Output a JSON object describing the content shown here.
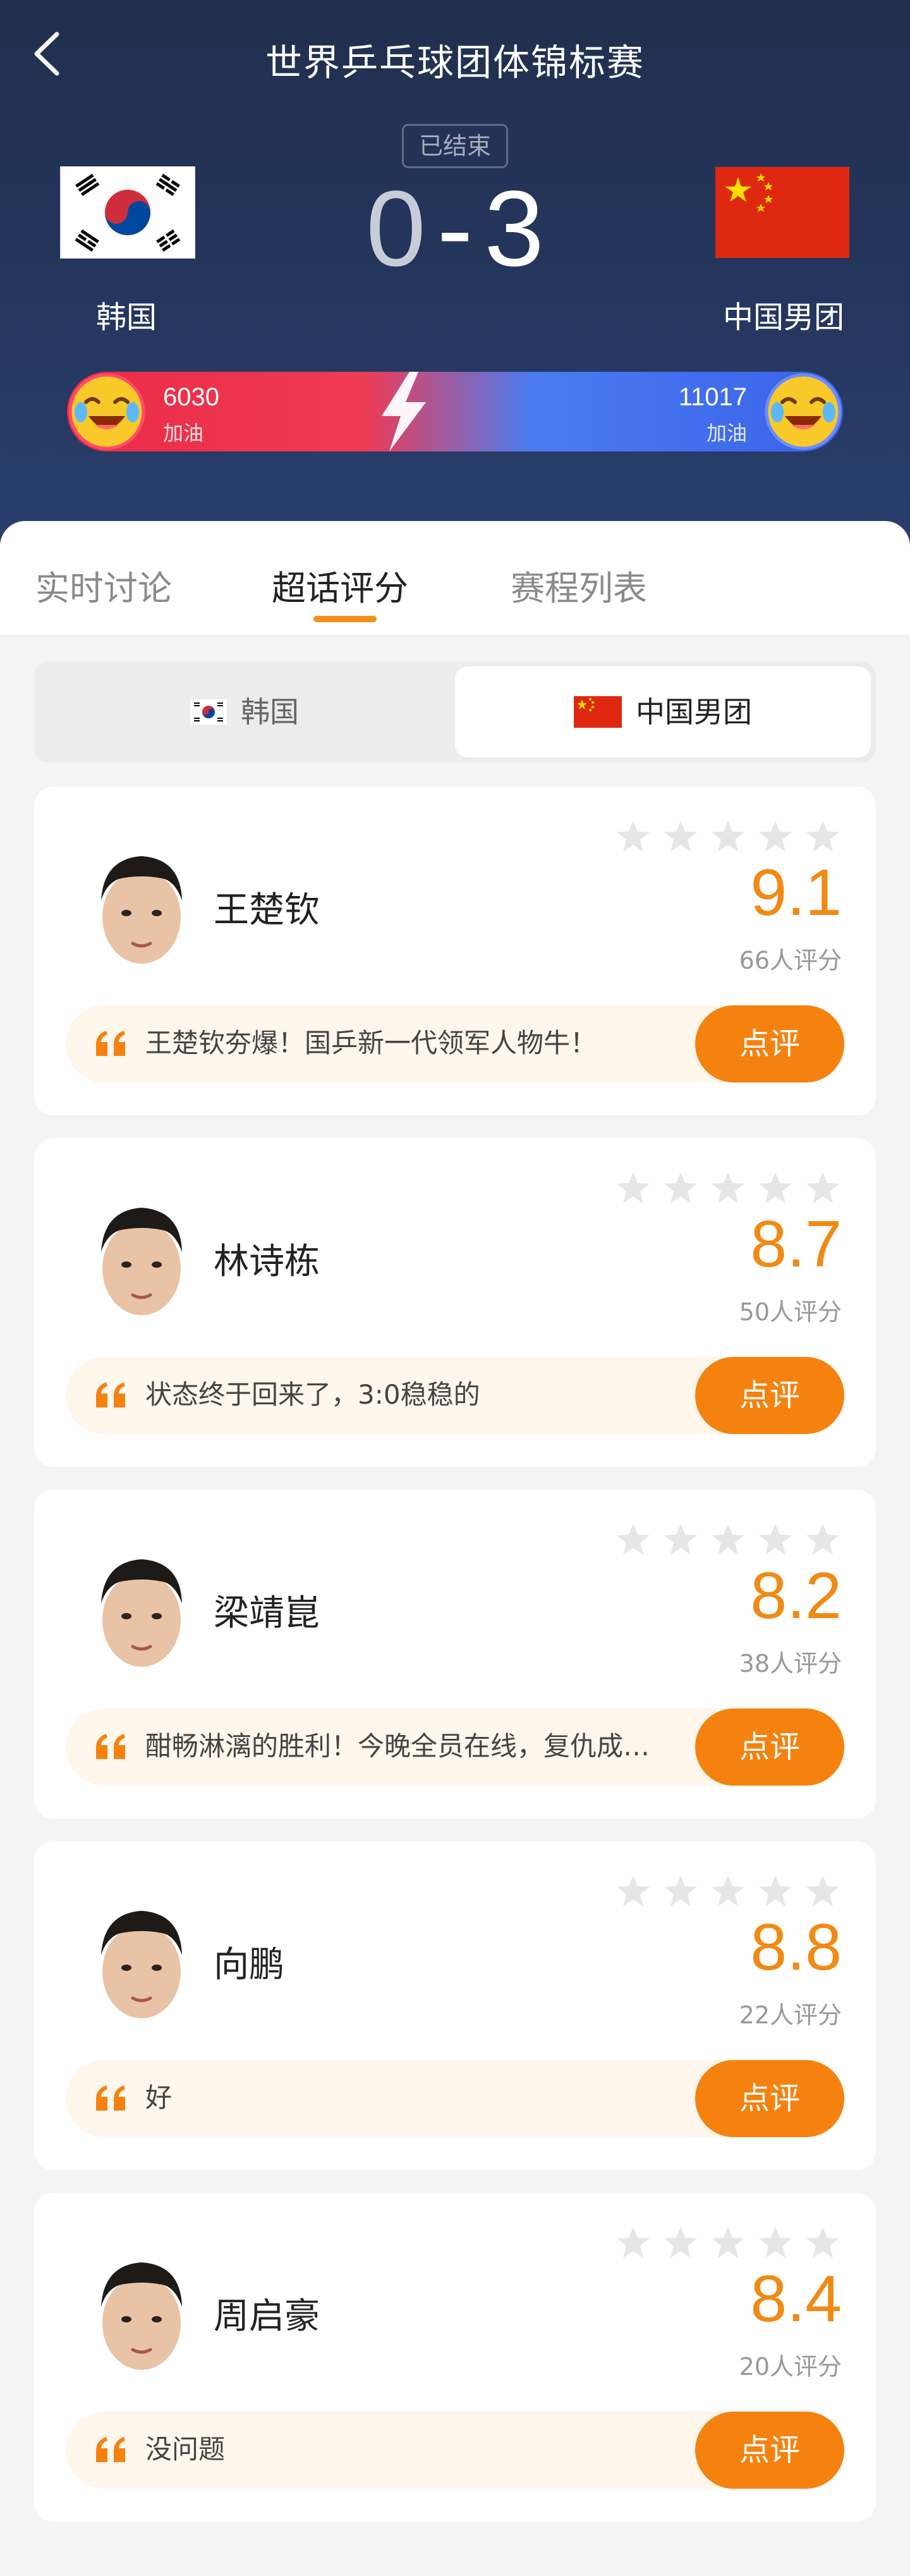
{
  "header": {
    "title": "世界乒乓球团体锦标赛",
    "status": "已结束"
  },
  "match": {
    "home_team": "韩国",
    "away_team": "中国男团",
    "home_score": "0",
    "away_score": "3",
    "separator": "-"
  },
  "cheer": {
    "home_count": "6030",
    "home_label": "加油",
    "away_count": "11017",
    "away_label": "加油"
  },
  "tabs": [
    {
      "label": "实时讨论"
    },
    {
      "label": "超话评分"
    },
    {
      "label": "赛程列表"
    }
  ],
  "team_toggle": {
    "home": "韩国",
    "away": "中国男团"
  },
  "players": [
    {
      "name": "王楚钦",
      "rating": "9.1",
      "count": "66人评分",
      "comment": "王楚钦夯爆！国乒新一代领军人物牛！",
      "button": "点评"
    },
    {
      "name": "林诗栋",
      "rating": "8.7",
      "count": "50人评分",
      "comment": "状态终于回来了，3:0稳稳的",
      "button": "点评"
    },
    {
      "name": "梁靖崑",
      "rating": "8.2",
      "count": "38人评分",
      "comment": "酣畅淋漓的胜利！今晚全员在线，复仇成…",
      "button": "点评"
    },
    {
      "name": "向鹏",
      "rating": "8.8",
      "count": "22人评分",
      "comment": "好",
      "button": "点评"
    },
    {
      "name": "周启豪",
      "rating": "8.4",
      "count": "20人评分",
      "comment": "没问题",
      "button": "点评"
    }
  ],
  "colors": {
    "accent": "#f5820f",
    "rating": "#f08a14",
    "home_cheer": "#ea2b47",
    "away_cheer": "#3a62ea",
    "header_bg": "#24355c"
  },
  "icons": [
    "back-arrow-icon",
    "lightning-icon",
    "star-icon",
    "quote-icon"
  ]
}
